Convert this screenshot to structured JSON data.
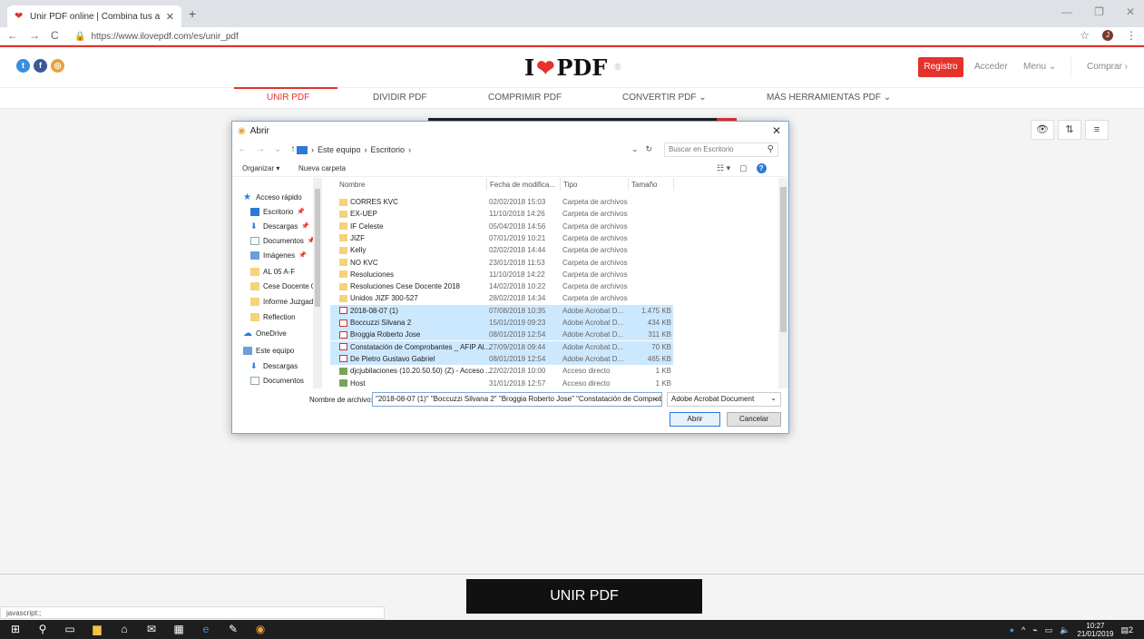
{
  "browser": {
    "tab_title": "Unir PDF online | Combina tus ar",
    "tab_close": "✕",
    "new_tab": "+",
    "url": "https://www.ilovepdf.com/es/unir_pdf",
    "avatar_letter": "J"
  },
  "site": {
    "logo_i": "I",
    "logo_pdf": "PDF",
    "registro": "Registro",
    "acceder": "Acceder",
    "menu": "Menu ⌄",
    "comprar": "Comprar ›",
    "nav": [
      {
        "label": "UNIR PDF",
        "active": true
      },
      {
        "label": "DIVIDIR PDF"
      },
      {
        "label": "COMPRIMIR PDF"
      },
      {
        "label": "CONVERTIR PDF ⌄"
      },
      {
        "label": "MÁS HERRAMIENTAS PDF ⌄"
      }
    ],
    "unir_button": "UNIR PDF",
    "status_text": "javascript:;",
    "accent": "#e5322d"
  },
  "dialog": {
    "title": "Abrir",
    "breadcrumb": [
      "Este equipo",
      "Escritorio"
    ],
    "search_placeholder": "Buscar en Escritorio",
    "organize": "Organizar ▾",
    "new_folder": "Nueva carpeta",
    "nav_items": [
      {
        "label": "Acceso rápido",
        "icon": "star-icon"
      },
      {
        "label": "Escritorio",
        "icon": "desktop-icon",
        "pinned": true
      },
      {
        "label": "Descargas",
        "icon": "download-icon",
        "pinned": true
      },
      {
        "label": "Documentos",
        "icon": "document-icon",
        "pinned": true
      },
      {
        "label": "Imágenes",
        "icon": "images-icon",
        "pinned": true
      },
      {
        "label": "AL 05 A-F",
        "icon": "folder-icon"
      },
      {
        "label": "Cese Docente 03",
        "icon": "folder-icon"
      },
      {
        "label": "Informe Juzgado",
        "icon": "folder-icon"
      },
      {
        "label": "Reflection",
        "icon": "folder-icon"
      },
      {
        "label": "OneDrive",
        "icon": "cloud-icon"
      },
      {
        "label": "Este equipo",
        "icon": "computer-icon"
      },
      {
        "label": "Descargas",
        "icon": "download-icon"
      },
      {
        "label": "Documentos",
        "icon": "document-icon"
      },
      {
        "label": "Escritorio",
        "icon": "desktop-icon",
        "selected": true
      }
    ],
    "columns": {
      "name": "Nombre",
      "date": "Fecha de modifica...",
      "type": "Tipo",
      "size": "Tamaño"
    },
    "files": [
      {
        "name": "CORRES KVC",
        "date": "02/02/2018 15:03",
        "type": "Carpeta de archivos",
        "size": "",
        "kind": "folder"
      },
      {
        "name": "EX-UEP",
        "date": "11/10/2018 14:26",
        "type": "Carpeta de archivos",
        "size": "",
        "kind": "folder"
      },
      {
        "name": "IF Celeste",
        "date": "05/04/2018 14:56",
        "type": "Carpeta de archivos",
        "size": "",
        "kind": "folder"
      },
      {
        "name": "JIZF",
        "date": "07/01/2019 10:21",
        "type": "Carpeta de archivos",
        "size": "",
        "kind": "folder"
      },
      {
        "name": "Kelly",
        "date": "02/02/2018 14:44",
        "type": "Carpeta de archivos",
        "size": "",
        "kind": "folder"
      },
      {
        "name": "NO KVC",
        "date": "23/01/2018 11:53",
        "type": "Carpeta de archivos",
        "size": "",
        "kind": "folder"
      },
      {
        "name": "Resoluciones",
        "date": "11/10/2018 14:22",
        "type": "Carpeta de archivos",
        "size": "",
        "kind": "folder"
      },
      {
        "name": "Resoluciones Cese Docente 2018",
        "date": "14/02/2018 10:22",
        "type": "Carpeta de archivos",
        "size": "",
        "kind": "folder"
      },
      {
        "name": "Unidos JIZF 300-527",
        "date": "28/02/2018 14:34",
        "type": "Carpeta de archivos",
        "size": "",
        "kind": "folder"
      },
      {
        "name": "2018-08-07 (1)",
        "date": "07/08/2018 10:35",
        "type": "Adobe Acrobat D...",
        "size": "1.475 KB",
        "kind": "pdf",
        "selected": true
      },
      {
        "name": "Boccuzzi Silvana 2",
        "date": "15/01/2019 09:23",
        "type": "Adobe Acrobat D...",
        "size": "434 KB",
        "kind": "pdf",
        "selected": true
      },
      {
        "name": "Broggia Roberto Jose",
        "date": "08/01/2019 12:54",
        "type": "Adobe Acrobat D...",
        "size": "311 KB",
        "kind": "pdf",
        "selected": true
      },
      {
        "name": "Constatación de Comprobantes _ AFIP Al...",
        "date": "27/09/2018 09:44",
        "type": "Adobe Acrobat D...",
        "size": "70 KB",
        "kind": "pdf",
        "selected": true
      },
      {
        "name": "De Pietro Gustavo Gabriel",
        "date": "08/01/2019 12:54",
        "type": "Adobe Acrobat D...",
        "size": "465 KB",
        "kind": "pdf",
        "selected": true
      },
      {
        "name": "djcjubilaciones (10.20.50.50) (Z) - Acceso ...",
        "date": "22/02/2018 10:00",
        "type": "Acceso directo",
        "size": "1 KB",
        "kind": "link"
      },
      {
        "name": "Host",
        "date": "31/01/2018 12:57",
        "type": "Acceso directo",
        "size": "1 KB",
        "kind": "link"
      }
    ],
    "filename_label": "Nombre de archivo:",
    "filename_value": "\"2018-08-07 (1)\" \"Boccuzzi Silvana 2\" \"Broggia Roberto Jose\" \"Constatación de Comprob",
    "filetype_value": "Adobe Acrobat Document",
    "open_button": "Abrir",
    "cancel_button": "Cancelar"
  },
  "taskbar": {
    "time": "10:27",
    "date": "21/01/2019",
    "notif_count": "2"
  }
}
